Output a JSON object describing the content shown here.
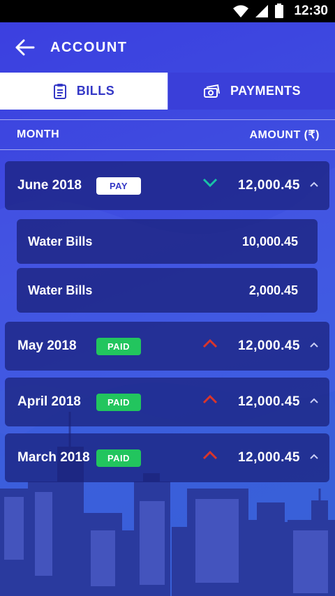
{
  "status_bar": {
    "time": "12:30"
  },
  "appbar": {
    "title": "ACCOUNT"
  },
  "tabs": [
    {
      "label": "BILLS",
      "icon": "clipboard-icon",
      "active": true
    },
    {
      "label": "PAYMENTS",
      "icon": "money-icon",
      "active": false
    }
  ],
  "header": {
    "month": "MONTH",
    "amount": "AMOUNT (₹)"
  },
  "bills": [
    {
      "month": "June 2018",
      "status": "PAY",
      "amount": "12,000.45",
      "subitems": [
        {
          "label": "Water Bills",
          "amount": "10,000.45"
        },
        {
          "label": "Water Bills",
          "amount": "2,000.45"
        }
      ]
    },
    {
      "month": "May 2018",
      "status": "PAID",
      "amount": "12,000.45"
    },
    {
      "month": "April 2018",
      "status": "PAID",
      "amount": "12,000.45"
    },
    {
      "month": "March 2018",
      "status": "PAID",
      "amount": "12,000.45"
    }
  ],
  "colors": {
    "pay_badge": "#ffffff",
    "paid_badge": "#22c55e",
    "down_arrow": "#19c3a6",
    "up_arrow": "#d9352b"
  }
}
